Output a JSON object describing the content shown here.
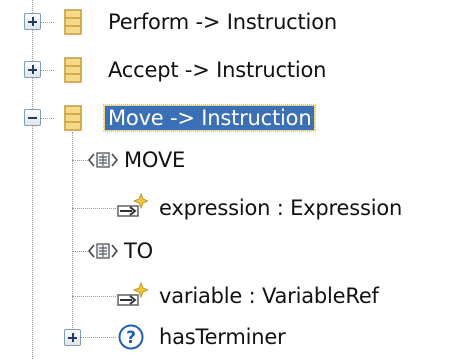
{
  "tree": {
    "nodes": [
      {
        "label": "Perform -> Instruction",
        "icon": "class-icon",
        "expander": "plus",
        "selected": false
      },
      {
        "label": "Accept -> Instruction",
        "icon": "class-icon",
        "expander": "plus",
        "selected": false
      },
      {
        "label": "Move -> Instruction",
        "icon": "class-icon",
        "expander": "minus",
        "selected": true,
        "children": [
          {
            "label": "MOVE",
            "icon": "keyword-icon"
          },
          {
            "label": "expression : Expression",
            "icon": "reference-icon"
          },
          {
            "label": "TO",
            "icon": "keyword-icon"
          },
          {
            "label": "variable : VariableRef",
            "icon": "reference-icon"
          },
          {
            "label": "hasTerminer",
            "icon": "question-icon",
            "expander": "plus"
          }
        ]
      }
    ]
  },
  "colors": {
    "selection_bg": "#3b6fb6",
    "class_icon_fill": "#f6d98a",
    "class_icon_border": "#c8a040",
    "question_icon": "#1f5fb8"
  }
}
